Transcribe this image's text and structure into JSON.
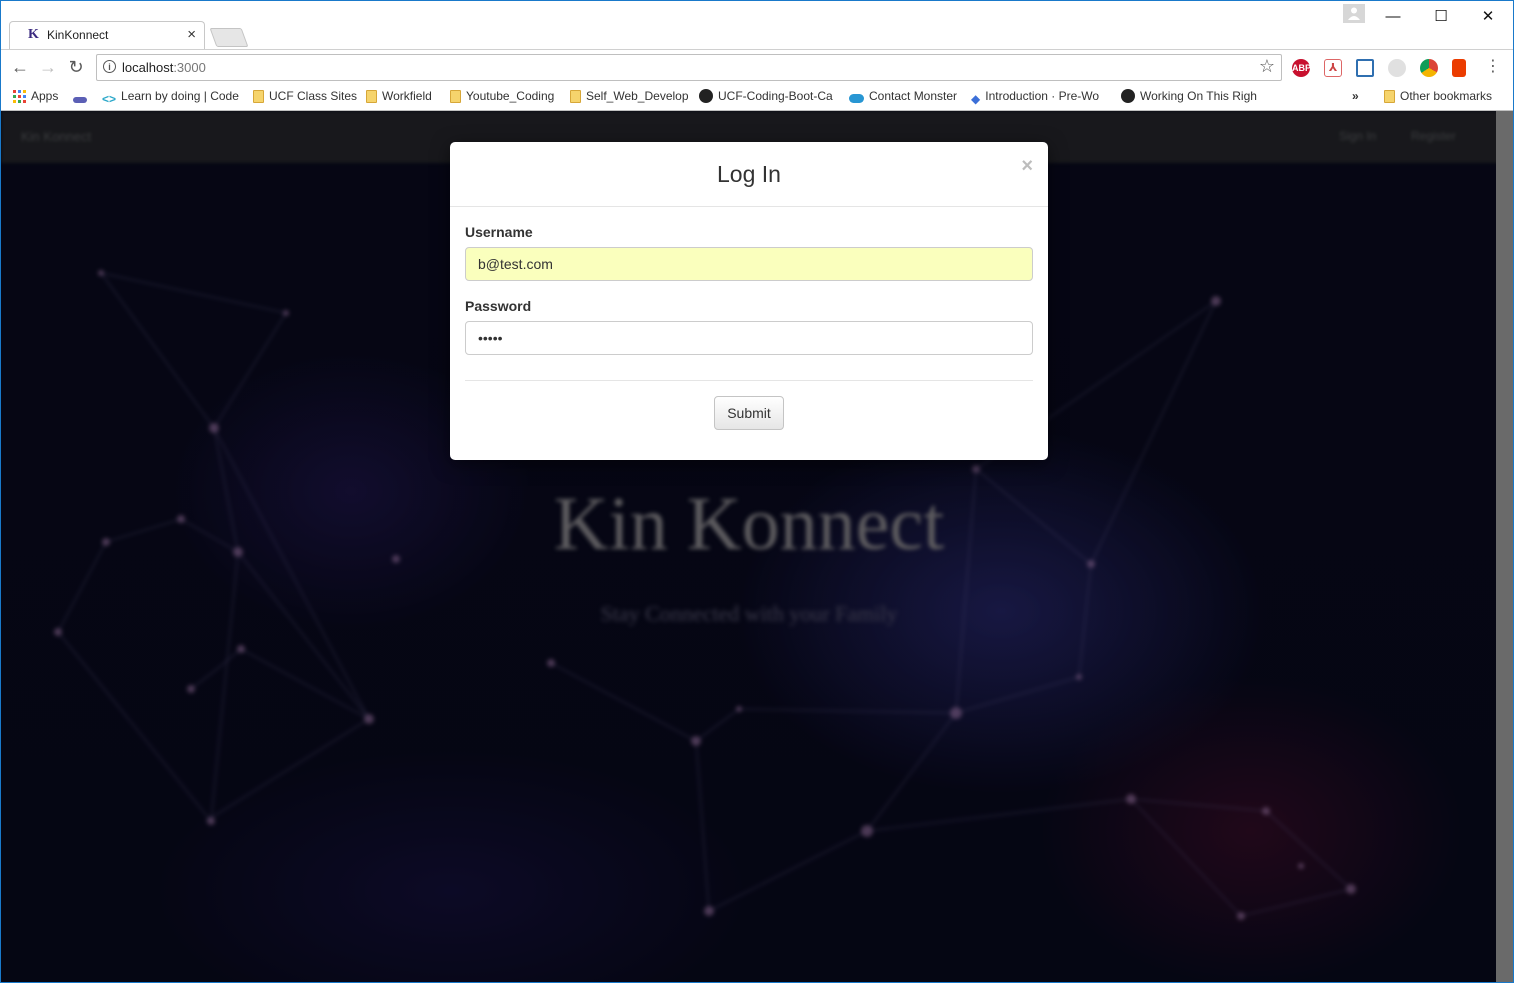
{
  "browser": {
    "tab": {
      "favicon": "K",
      "title": "KinKonnect"
    },
    "window_controls": {
      "minimize": "—",
      "maximize": "☐",
      "close": "✕"
    },
    "address": {
      "host": "localhost",
      "port": ":3000"
    },
    "bookmarks": [
      {
        "label": "Apps",
        "icon": "apps-grid-icon"
      },
      {
        "label": "",
        "icon": "link-icon"
      },
      {
        "label": "Learn by doing | Code",
        "icon": "code-icon"
      },
      {
        "label": "UCF Class Sites",
        "icon": "folder-icon"
      },
      {
        "label": "Workfield",
        "icon": "folder-icon"
      },
      {
        "label": "Youtube_Coding",
        "icon": "folder-icon"
      },
      {
        "label": "Self_Web_Develop",
        "icon": "folder-icon"
      },
      {
        "label": "UCF-Coding-Boot-Ca",
        "icon": "github-icon"
      },
      {
        "label": "Contact Monster",
        "icon": "cloud-icon"
      },
      {
        "label": "Introduction · Pre-Wo",
        "icon": "layers-icon"
      },
      {
        "label": "Working On This Righ",
        "icon": "github-icon"
      }
    ],
    "bookmarks_overflow": "»",
    "other_bookmarks": "Other bookmarks"
  },
  "page": {
    "nav": {
      "brand": "Kin Konnect",
      "links": [
        "Sign In",
        "Register"
      ]
    },
    "hero": {
      "title": "Kin Konnect",
      "subtitle": "Stay Connected with your Family"
    }
  },
  "modal": {
    "title": "Log In",
    "close": "×",
    "username": {
      "label": "Username",
      "value": "b@test.com"
    },
    "password": {
      "label": "Password",
      "value": "•••••"
    },
    "submit": "Submit"
  },
  "colors": {
    "autofill": "#faffbd",
    "window_border": "#1979ca"
  }
}
